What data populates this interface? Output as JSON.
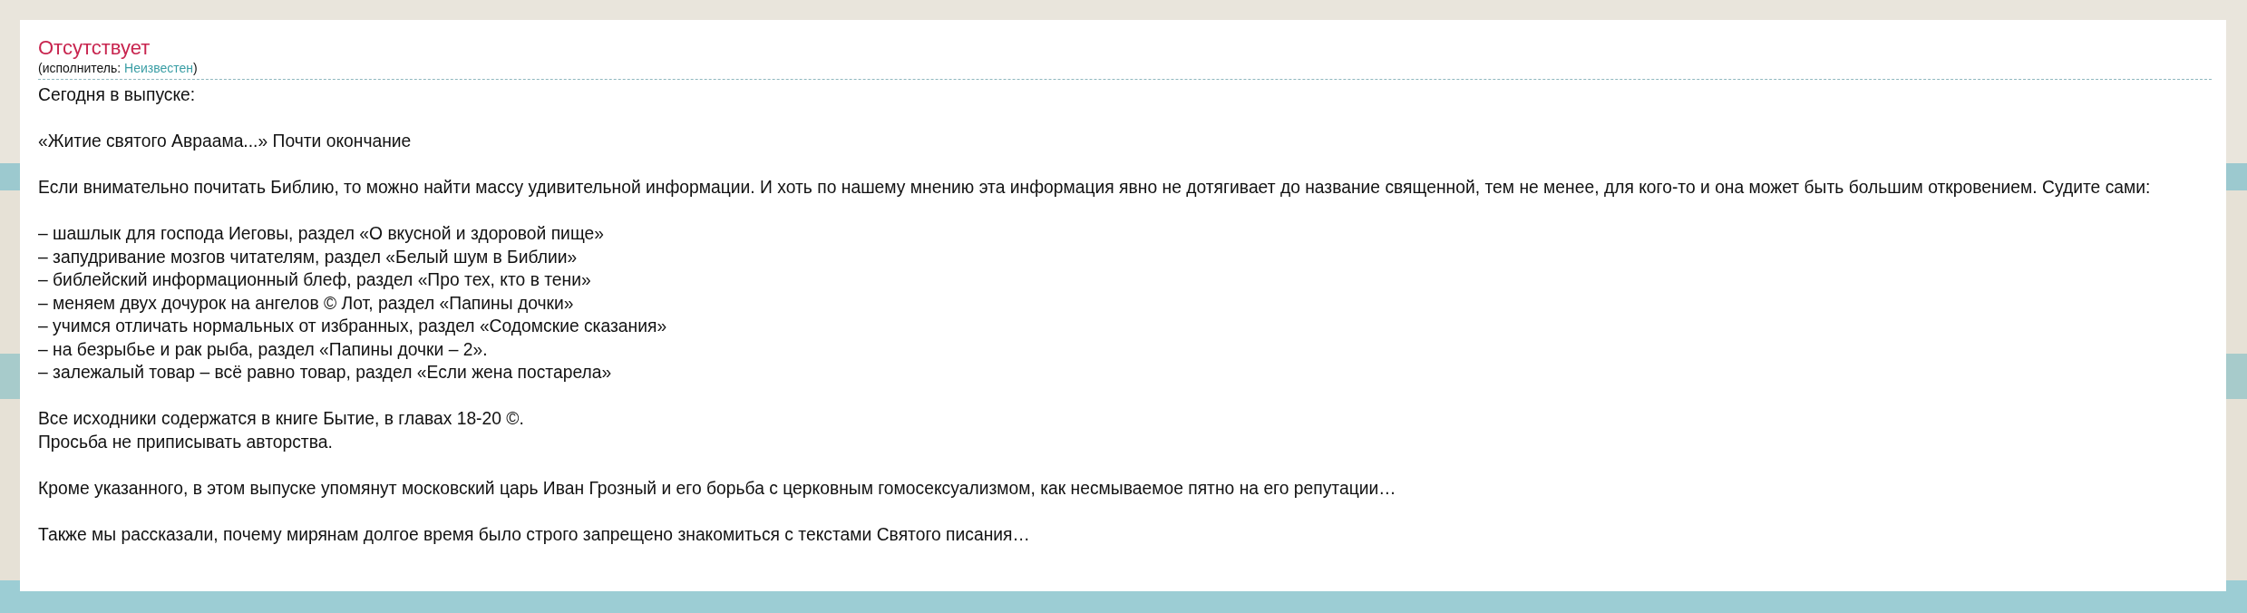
{
  "song": {
    "title": "Отсутствует",
    "performer_label": "(исполнитель: ",
    "performer": "Неизвестен",
    "performer_close": ")"
  },
  "paragraphs": [
    {
      "lines": [
        "Сегодня в выпуске:"
      ]
    },
    {
      "lines": [
        "«Житие святого Авраама...» Почти окончание"
      ]
    },
    {
      "lines": [
        "Если внимательно почитать Библию, то можно найти массу удивительной информации. И хоть по нашему мнению эта информация явно не дотягивает до название священной, тем не менее, для кого-то и она может быть большим откровением. Судите сами:"
      ]
    },
    {
      "lines": [
        "– шашлык для господа Иеговы, раздел «О вкусной и здоровой пище»",
        "– запудривание мозгов читателям, раздел «Белый шум в Библии»",
        "– библейский информационный блеф, раздел «Про тех, кто в тени»",
        "– меняем двух дочурок на ангелов © Лот, раздел «Папины дочки»",
        "– учимся отличать нормальных от избранных, раздел «Содомские сказания»",
        "– на безрыбье и рак рыба, раздел «Папины дочки – 2».",
        "– залежалый товар – всё равно товар, раздел «Если жена постарела»"
      ]
    },
    {
      "lines": [
        "Все исходники содержатся в книге Бытие, в главах 18-20 ©.",
        "Просьба не приписывать авторства."
      ]
    },
    {
      "lines": [
        "Кроме указанного, в этом выпуске упомянут московский царь Иван Грозный и его борьба с церковным гомосексуализмом, как несмываемое пятно на его репутации…"
      ]
    },
    {
      "lines": [
        "Также мы рассказали, почему мирянам долгое время было строго запрещено знакомиться с текстами Святого писания…"
      ]
    }
  ]
}
